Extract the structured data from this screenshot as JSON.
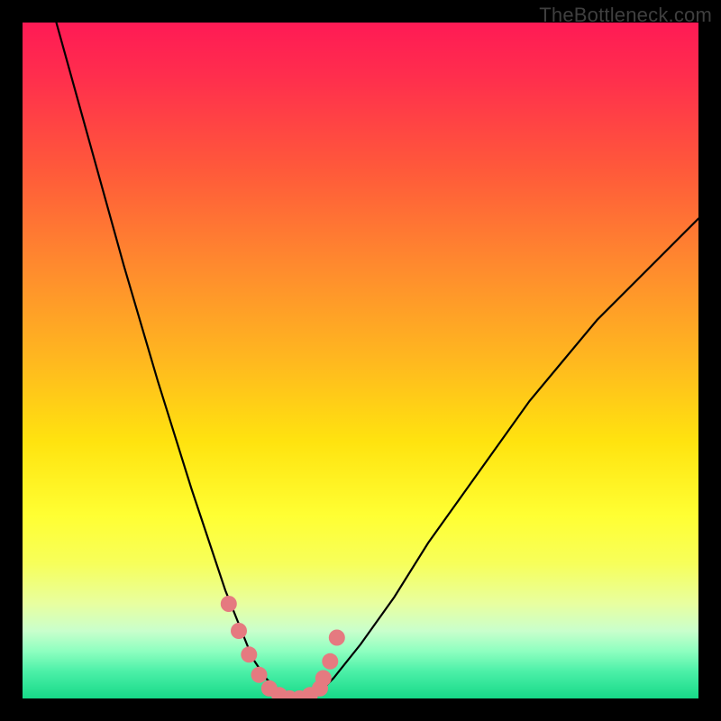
{
  "watermark": "TheBottleneck.com",
  "chart_data": {
    "type": "line",
    "title": "",
    "xlabel": "",
    "ylabel": "",
    "xlim": [
      0,
      100
    ],
    "ylim": [
      0,
      100
    ],
    "gradient_stops": [
      {
        "pos": 0,
        "color": "#ff1a55"
      },
      {
        "pos": 8,
        "color": "#ff2e4d"
      },
      {
        "pos": 22,
        "color": "#ff5a3a"
      },
      {
        "pos": 36,
        "color": "#ff8a2e"
      },
      {
        "pos": 50,
        "color": "#ffb81f"
      },
      {
        "pos": 62,
        "color": "#ffe30f"
      },
      {
        "pos": 73,
        "color": "#ffff33"
      },
      {
        "pos": 80,
        "color": "#f7ff5a"
      },
      {
        "pos": 86,
        "color": "#e8ffa0"
      },
      {
        "pos": 90,
        "color": "#c9ffcc"
      },
      {
        "pos": 93,
        "color": "#8effc0"
      },
      {
        "pos": 96,
        "color": "#4cf0a8"
      },
      {
        "pos": 100,
        "color": "#17d988"
      }
    ],
    "series": [
      {
        "name": "bottleneck-curve",
        "x": [
          5,
          10,
          15,
          20,
          25,
          28,
          30,
          32,
          34,
          36,
          38,
          40,
          42,
          44,
          46,
          50,
          55,
          60,
          65,
          70,
          75,
          80,
          85,
          90,
          95,
          100
        ],
        "y": [
          100,
          82,
          64,
          47,
          31,
          22,
          16,
          11,
          6,
          3,
          1,
          0,
          0,
          1,
          3,
          8,
          15,
          23,
          30,
          37,
          44,
          50,
          56,
          61,
          66,
          71
        ]
      }
    ],
    "highlight_points": {
      "name": "near-optimum-markers",
      "color": "#e57a80",
      "x": [
        30.5,
        32,
        33.5,
        35,
        36.5,
        38,
        39.5,
        41,
        42.5,
        44,
        44.5,
        45.5,
        46.5
      ],
      "y": [
        14,
        10,
        6.5,
        3.5,
        1.5,
        0.5,
        0,
        0,
        0.5,
        1.5,
        3,
        5.5,
        9
      ]
    }
  }
}
